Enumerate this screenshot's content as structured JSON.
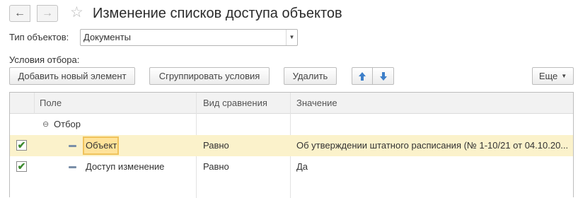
{
  "header": {
    "title": "Изменение списков доступа объектов",
    "back_icon": "←",
    "forward_icon": "→",
    "star_icon": "☆"
  },
  "object_type": {
    "label": "Тип объектов:",
    "value": "Документы",
    "arrow": "▼"
  },
  "filter": {
    "label": "Условия отбора:"
  },
  "toolbar": {
    "add_label": "Добавить новый элемент",
    "group_label": "Сгруппировать условия",
    "delete_label": "Удалить",
    "up_icon": "🡅",
    "down_icon": "🡇",
    "more_label": "Еще",
    "more_caret": "▼"
  },
  "table": {
    "columns": [
      "Поле",
      "Вид сравнения",
      "Значение"
    ],
    "group_row": {
      "toggle": "⊖",
      "label": "Отбор"
    },
    "rows": [
      {
        "checked": "✔",
        "field": "Объект",
        "comparison": "Равно",
        "value": "Об утверждении штатного расписания (№ 1-10/21 от 04.10.20..."
      },
      {
        "checked": "✔",
        "field": "Доступ изменение",
        "comparison": "Равно",
        "value": "Да"
      }
    ]
  },
  "colors": {
    "selected_row": "#fbf2cb",
    "focus_cell": "#ffe39a",
    "arrow_blue": "#3d7fc9"
  }
}
